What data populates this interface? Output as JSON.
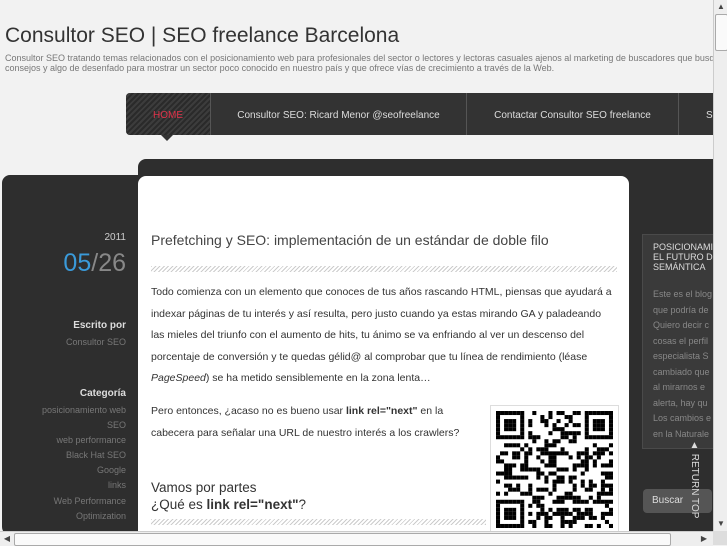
{
  "site": {
    "title": "Consultor SEO | SEO freelance Barcelona",
    "description": "Consultor SEO tratando temas relacionados con el posicionamiento web para profesionales del sector o lectores y lectoras casuales ajenos al marketing de buscadores que busquen consejos y algo de desenfado para mostrar un sector poco conocido en nuestro país y que ofrece vías de crecimiento a través de la Web."
  },
  "nav": {
    "items": [
      "HOME",
      "Consultor SEO: Ricard Menor @seofreelance",
      "Contactar Consultor SEO freelance",
      "S"
    ]
  },
  "post": {
    "year": "2011",
    "month": "05",
    "day": "26",
    "author_heading": "Escrito por",
    "author": "Consultor SEO",
    "category_heading": "Categoría",
    "categories": [
      "posicionamiento web SEO",
      "web performance",
      "Black Hat SEO",
      "Google",
      "links",
      "Web Performance Optimization"
    ],
    "title": "Prefetching y SEO: implementación de un estándar de doble filo",
    "para1_before": "Todo comienza con un elemento que conoces de tus años rascando HTML, piensas que ayudará a indexar páginas de tu interés y así resulta, pero justo cuando ya estas mirando GA y paladeando las mieles del triunfo con el aumento de hits, tu ánimo se va enfriando al ver un descenso del porcentaje de conversión y te quedas gélid@ al comprobar que tu línea de rendimiento (léase ",
    "para1_em": "PageSpeed",
    "para1_after": ") se ha metido sensiblemente en la zona lenta…",
    "para2_before": "Pero entonces, ¿acaso no es bueno usar ",
    "para2_bold": "link rel=\"next\"",
    "para2_after": " en la cabecera para señalar una URL de nuestro interés a los crawlers?",
    "subheading_line1": "Vamos por partes",
    "subheading_line2_before": "¿Qué es ",
    "subheading_line2_bold": "link rel=\"next\"",
    "subheading_line2_after": "?"
  },
  "sidebar": {
    "widget_title": "POSICIONAMIENTO EL FUTURO DE SEMÁNTICA",
    "widget_lines": [
      "Este es el blog",
      "que podría de",
      "Quiero decir c",
      "cosas el perfil",
      "especialista S",
      "cambiado que",
      "al mirarnos e",
      "alerta, hay qu",
      "Los cambios e",
      "en la Naturale"
    ],
    "search_label": "Buscar",
    "return_top": "RETURN TOP"
  },
  "colors": {
    "accent_blue": "#3a9ad9",
    "nav_active": "#e0334a",
    "dark": "#2e2e2e"
  }
}
